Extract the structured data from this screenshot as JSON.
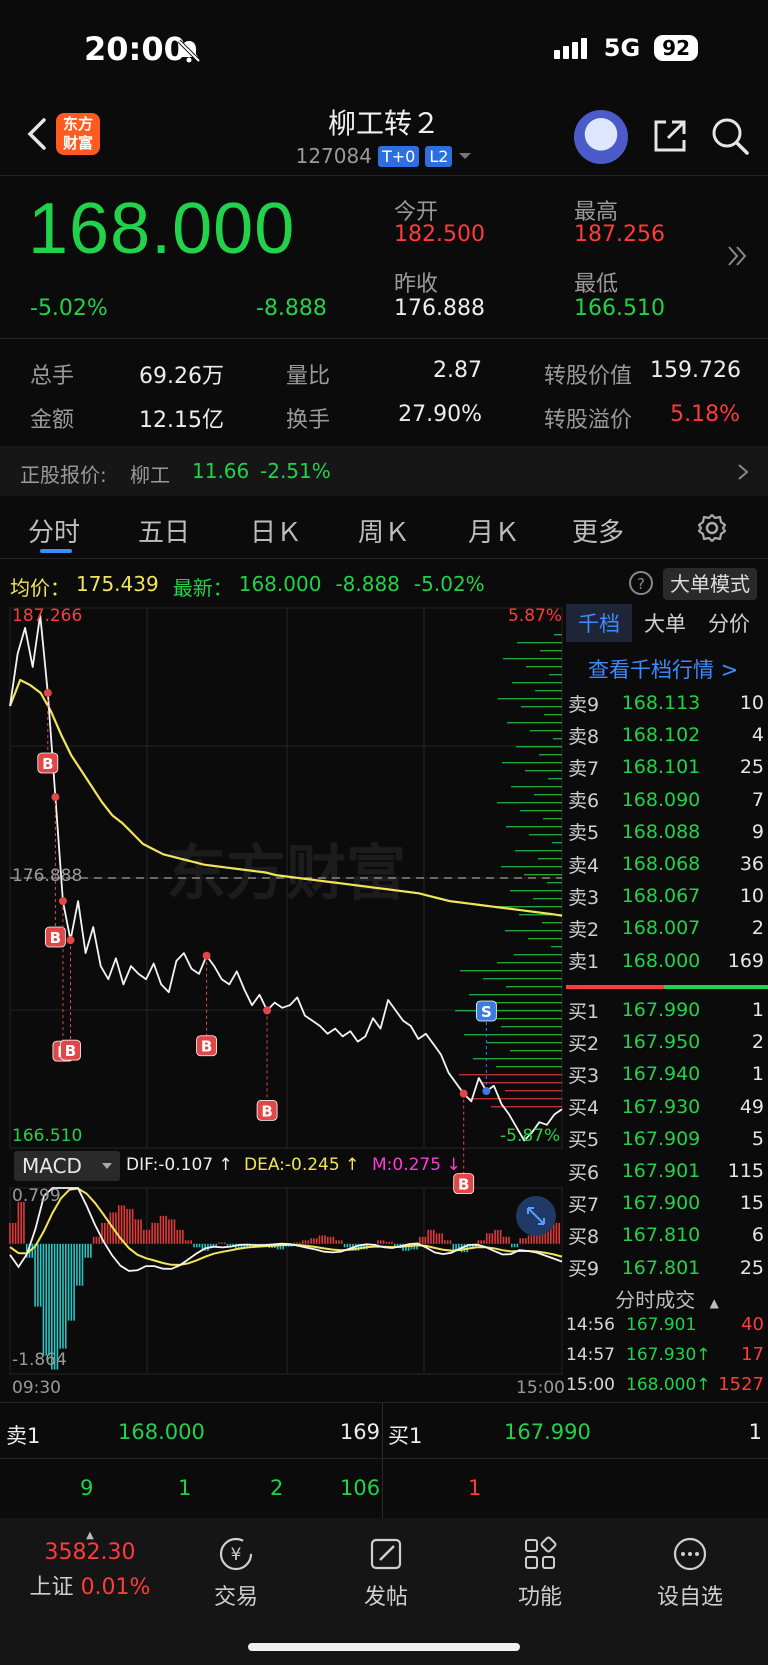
{
  "status": {
    "time": "20:00",
    "network": "5G",
    "battery": "92"
  },
  "header": {
    "logo_line1": "东方",
    "logo_line2": "财富",
    "title": "柳工转２",
    "code": "127084",
    "tag1": "T+0",
    "tag2": "L2"
  },
  "quote": {
    "price": "168.000",
    "pct": "-5.02%",
    "change": "-8.888",
    "open_label": "今开",
    "open": "182.500",
    "high_label": "最高",
    "high": "187.256",
    "prev_label": "昨收",
    "prev": "176.888",
    "low_label": "最低",
    "low": "166.510"
  },
  "stats": {
    "vol_label": "总手",
    "vol": "69.26万",
    "ratio_label": "量比",
    "ratio": "2.87",
    "conv_label": "转股价值",
    "conv": "159.726",
    "amt_label": "金额",
    "amt": "12.15亿",
    "turn_label": "换手",
    "turn": "27.90%",
    "prem_label": "转股溢价",
    "prem": "5.18%"
  },
  "stock_quote": {
    "label": "正股报价:",
    "name": "柳工",
    "price": "11.66",
    "pct": "-2.51%"
  },
  "tabs": [
    "分时",
    "五日",
    "日Ｋ",
    "周Ｋ",
    "月Ｋ",
    "更多"
  ],
  "info_line": {
    "avg_label": "均价：",
    "avg": "175.439",
    "last_label": "最新：",
    "last": "168.000",
    "chg": "-8.888",
    "pct": "-5.02%"
  },
  "dadan_mode": "大单模式",
  "colors": {
    "up": "#ff3b3b",
    "down": "#21d24a",
    "avg_line": "#f2e45a",
    "accent": "#3d8bff"
  },
  "chart_data": [
    {
      "type": "line",
      "ylim": [
        166.51,
        187.266
      ],
      "y_top_label": "187.266",
      "y_bottom_label": "166.510",
      "ref_label": "176.888",
      "ref_value": 176.888,
      "pct_top": "5.87%",
      "pct_bottom": "-5.87%",
      "x_labels": [
        "09:30",
        "15:00"
      ],
      "series": [
        {
          "values": [
            183.5,
            185.5,
            186.5,
            185,
            187,
            184,
            180,
            176,
            174.5,
            176,
            174,
            175,
            173.5,
            173,
            173.8,
            172.8,
            173.5,
            173.2,
            173,
            173.6,
            172.8,
            172.5,
            173.7,
            174,
            173.4,
            173.2,
            173.9,
            173.5,
            173,
            172.8,
            173.3,
            172.6,
            172,
            172.4,
            171.8,
            172.1,
            171.9,
            172,
            172.3,
            171.6,
            171.4,
            171.2,
            170.9,
            171.1,
            170.8,
            171,
            170.6,
            170.8,
            171.5,
            171.1,
            172.2,
            171.8,
            171.4,
            171.2,
            170.7,
            170.9,
            170.5,
            170.1,
            169.4,
            169,
            168.6,
            168.3,
            169.2,
            168.7,
            168.9,
            168.2,
            167.8,
            167.3,
            166.8,
            167.1,
            167.5,
            167.4,
            167.8,
            168
          ]
        },
        {
          "values": [
            183.5,
            184.5,
            184.3,
            184,
            183.3,
            182.4,
            181.6,
            181,
            180.4,
            179.8,
            179.3,
            179,
            178.6,
            178.2,
            178,
            177.8,
            177.7,
            177.6,
            177.5,
            177.4,
            177.35,
            177.3,
            177.25,
            177.2,
            177.15,
            177.1,
            177,
            176.95,
            176.9,
            176.85,
            176.8,
            176.75,
            176.7,
            176.65,
            176.6,
            176.55,
            176.5,
            176.45,
            176.4,
            176.35,
            176.3,
            176.2,
            176.1,
            176,
            175.95,
            175.9,
            175.85,
            175.8,
            175.75,
            175.7,
            175.65,
            175.6,
            175.55,
            175.5,
            175.44
          ]
        }
      ],
      "markers": [
        "B",
        "B",
        "B",
        "B",
        "B",
        "B",
        "B",
        "S"
      ]
    },
    {
      "type": "bar",
      "title": "MACD",
      "dif_label": "DIF:-0.107 ↑",
      "dea_label": "DEA:-0.245 ↑",
      "m_label": "M:0.275 ↓",
      "ylim": [
        -1.864,
        0.799
      ],
      "y_top_label": "0.799",
      "y_bottom_label": "-1.864",
      "values": [
        0.3,
        0.6,
        -0.2,
        -0.9,
        -1.6,
        -1.8,
        -1.5,
        -1.1,
        -0.6,
        -0.2,
        0.1,
        0.3,
        0.45,
        0.55,
        0.5,
        0.35,
        0.2,
        0.3,
        0.4,
        0.35,
        0.2,
        0.05,
        -0.05,
        -0.1,
        -0.05,
        0.02,
        -0.03,
        -0.08,
        -0.05,
        -0.02,
        -0.04,
        -0.06,
        -0.08,
        -0.04,
        0.02,
        0.05,
        0.08,
        0.12,
        0.1,
        0.05,
        -0.05,
        -0.1,
        -0.08,
        -0.02,
        0.05,
        0.03,
        -0.06,
        -0.1,
        -0.08,
        0.1,
        0.2,
        0.15,
        0.05,
        -0.08,
        -0.12,
        -0.05,
        0.05,
        0.15,
        0.2,
        0.1,
        -0.05,
        0.08,
        0.12,
        0.2,
        0.25,
        0.3
      ]
    }
  ],
  "orderbook": {
    "tabs": [
      "千档",
      "大单",
      "分价"
    ],
    "view_link": "查看千档行情 >",
    "asks": [
      {
        "label": "卖9",
        "price": "168.113",
        "vol": "10"
      },
      {
        "label": "卖8",
        "price": "168.102",
        "vol": "4"
      },
      {
        "label": "卖7",
        "price": "168.101",
        "vol": "25"
      },
      {
        "label": "卖6",
        "price": "168.090",
        "vol": "7"
      },
      {
        "label": "卖5",
        "price": "168.088",
        "vol": "9"
      },
      {
        "label": "卖4",
        "price": "168.068",
        "vol": "36"
      },
      {
        "label": "卖3",
        "price": "168.067",
        "vol": "10"
      },
      {
        "label": "卖2",
        "price": "168.007",
        "vol": "2"
      },
      {
        "label": "卖1",
        "price": "168.000",
        "vol": "169"
      }
    ],
    "bids": [
      {
        "label": "买1",
        "price": "167.990",
        "vol": "1"
      },
      {
        "label": "买2",
        "price": "167.950",
        "vol": "2"
      },
      {
        "label": "买3",
        "price": "167.940",
        "vol": "1"
      },
      {
        "label": "买4",
        "price": "167.930",
        "vol": "49"
      },
      {
        "label": "买5",
        "price": "167.909",
        "vol": "5"
      },
      {
        "label": "买6",
        "price": "167.901",
        "vol": "115"
      },
      {
        "label": "买7",
        "price": "167.900",
        "vol": "15"
      },
      {
        "label": "买8",
        "price": "167.810",
        "vol": "6"
      },
      {
        "label": "买9",
        "price": "167.801",
        "vol": "25"
      }
    ],
    "trades_title": "分时成交",
    "trades": [
      {
        "time": "14:56",
        "price": "167.901",
        "vol": "40"
      },
      {
        "time": "14:57",
        "price": "167.930↑",
        "vol": "17"
      },
      {
        "time": "15:00",
        "price": "168.000↑",
        "vol": "1527"
      }
    ]
  },
  "summary": {
    "sell_label": "卖1",
    "sell_price": "168.000",
    "sell_vol": "169",
    "buy_label": "买1",
    "buy_price": "167.990",
    "buy_vol": "1",
    "sell_queue": [
      "9",
      "1",
      "2",
      "106"
    ],
    "buy_queue": [
      "1"
    ]
  },
  "nav": {
    "index_value": "3582.30",
    "index_name": "上证",
    "index_pct": "0.01%",
    "items": [
      "交易",
      "发帖",
      "功能",
      "设自选"
    ]
  }
}
